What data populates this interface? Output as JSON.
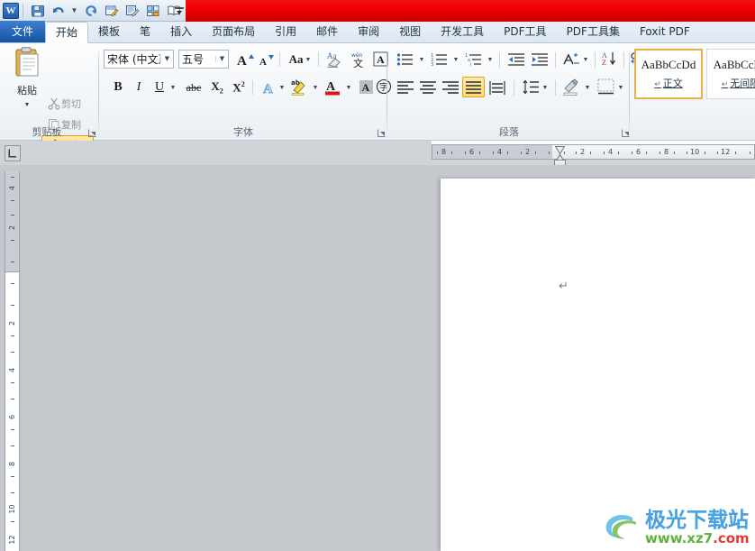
{
  "titlebar": {
    "app_logo": "word-logo",
    "logo_letter": "W",
    "quick_access": [
      {
        "name": "save-icon",
        "label": "保存"
      },
      {
        "name": "undo-icon",
        "label": "撤消"
      },
      {
        "name": "undo-dropdown-icon",
        "label": "撤消下拉"
      },
      {
        "name": "redo-icon",
        "label": "恢复"
      },
      {
        "name": "edit-doc-icon",
        "label": "编辑"
      },
      {
        "name": "review-doc-icon",
        "label": "审阅"
      },
      {
        "name": "layout-icon",
        "label": "版式"
      },
      {
        "name": "book-view-icon",
        "label": "阅读"
      },
      {
        "name": "customize-qat-icon",
        "label": "自定义快速访问工具栏"
      }
    ],
    "banner_color": "#ee0000"
  },
  "tabs": [
    {
      "label": "文件",
      "state": "file"
    },
    {
      "label": "开始",
      "state": "active"
    },
    {
      "label": "模板",
      "state": "normal"
    },
    {
      "label": "笔",
      "state": "normal"
    },
    {
      "label": "插入",
      "state": "normal"
    },
    {
      "label": "页面布局",
      "state": "normal"
    },
    {
      "label": "引用",
      "state": "normal"
    },
    {
      "label": "邮件",
      "state": "normal"
    },
    {
      "label": "审阅",
      "state": "normal"
    },
    {
      "label": "视图",
      "state": "normal"
    },
    {
      "label": "开发工具",
      "state": "normal"
    },
    {
      "label": "PDF工具",
      "state": "normal"
    },
    {
      "label": "PDF工具集",
      "state": "normal"
    },
    {
      "label": "Foxit PDF",
      "state": "normal"
    }
  ],
  "ribbon": {
    "clipboard": {
      "group_label": "剪贴板",
      "paste_label": "粘贴",
      "cut_label": "剪切",
      "copy_label": "复制",
      "format_painter_label": "格式刷",
      "format_painter_selected": true
    },
    "font": {
      "group_label": "字体",
      "font_name": "宋体 (中文正)",
      "font_size": "五号",
      "grow_font": "增大字号",
      "shrink_font": "减小字号",
      "change_case": "Aa",
      "clear_format": "清除格式",
      "phonetic_guide": "拼音指南",
      "char_border": "字符边框",
      "bold": "B",
      "italic": "I",
      "underline": "U",
      "strikethrough": "abc",
      "subscript": "下标",
      "superscript": "上标",
      "text_effect": "文本效果",
      "highlight": "突出显示",
      "font_color": "字体颜色",
      "char_shading": "字符底纹",
      "enclose_char": "带圈字符"
    },
    "paragraph": {
      "group_label": "段落",
      "bullets": "项目符号",
      "numbering": "编号",
      "multilevel": "多级列表",
      "decrease_indent": "减少缩进量",
      "increase_indent": "增加缩进量",
      "sort_ab": "中文版式",
      "sort_az": "排序",
      "show_marks": "显示编辑标记",
      "align_left": "左对齐",
      "align_center": "居中",
      "align_right": "右对齐",
      "align_justify": "两端对齐",
      "align_distribute": "分散对齐",
      "justify_selected": true,
      "line_spacing": "行和段落间距",
      "shading": "底纹",
      "borders": "边框"
    },
    "styles": {
      "items": [
        {
          "sample": "AaBbCcDd",
          "name": "正文",
          "selected": true
        },
        {
          "sample": "AaBbCcDd",
          "name": "无间隔",
          "selected": false
        }
      ]
    }
  },
  "ruler": {
    "tab_selector": "L",
    "horizontal_marks_left": [
      "8",
      "6",
      "4",
      "2"
    ],
    "horizontal_marks_right": [
      "2",
      "4",
      "6",
      "8",
      "10",
      "12"
    ],
    "vertical_marks_gray": [
      "4",
      "2"
    ],
    "vertical_marks_white": [
      "2",
      "4",
      "6",
      "8",
      "10",
      "12"
    ]
  },
  "document": {
    "paragraph_mark": "↵",
    "background_color": "#c5c9ce",
    "page_color": "#ffffff"
  },
  "watermark": {
    "title": "极光下载站",
    "url_prefix": "www.xz7",
    "url_suffix": ".com"
  }
}
